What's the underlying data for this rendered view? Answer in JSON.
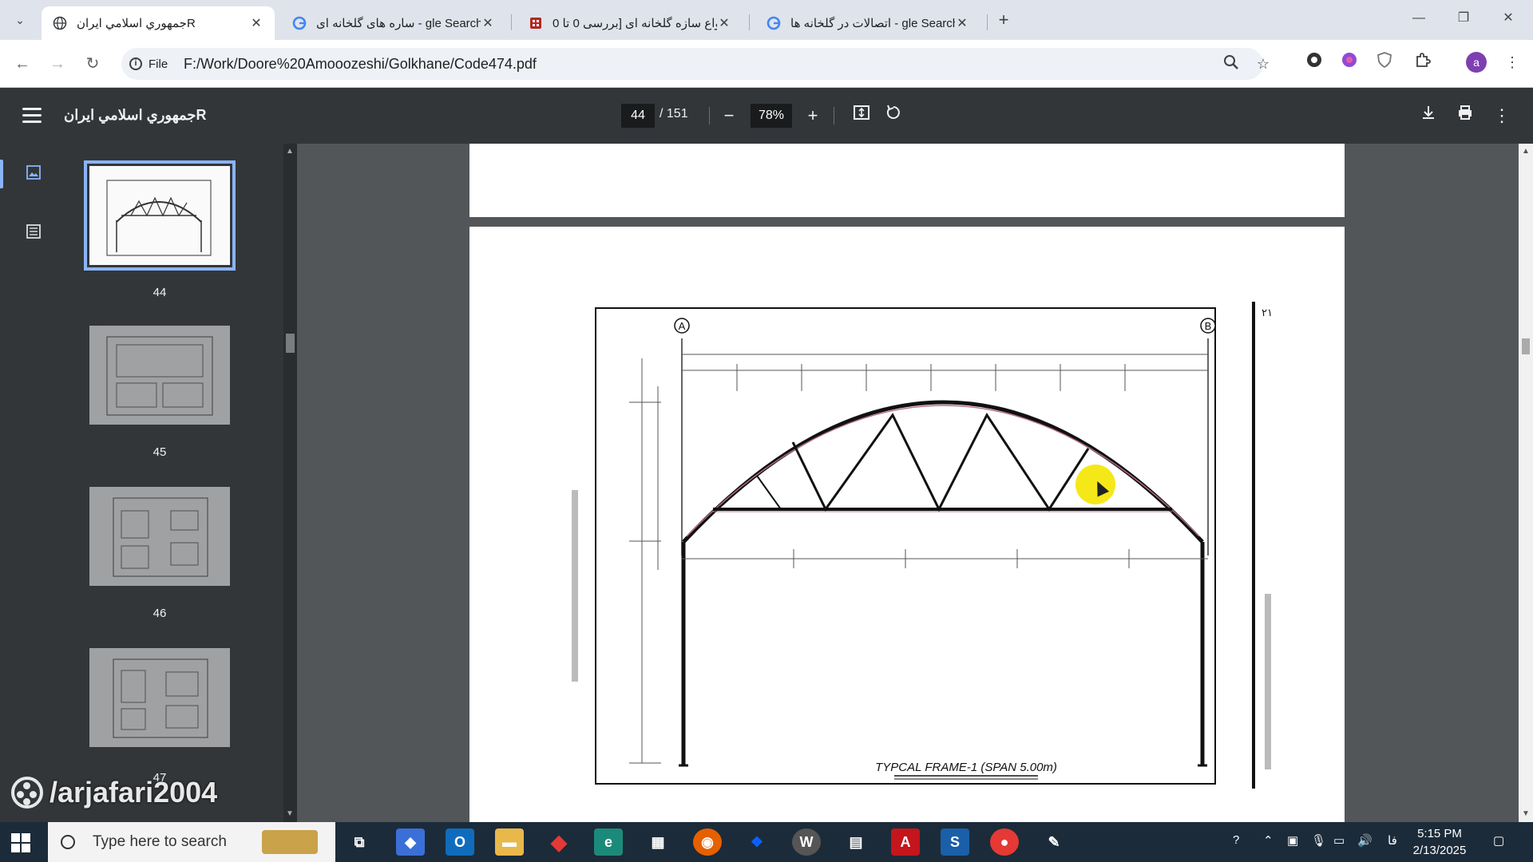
{
  "browser": {
    "tabs": [
      {
        "title": "جمهوري اسلامي ايرانR",
        "active": true,
        "favicon": "globe-icon"
      },
      {
        "title": "ساره های گلخانه ای - gle Search",
        "active": false,
        "favicon": "google-icon"
      },
      {
        "title": "انواع سازه گلخانه ای [بررسی 0 تا 0",
        "active": false,
        "favicon": "site-icon"
      },
      {
        "title": "اتصالات در گلخانه ها - gle Search",
        "active": false,
        "favicon": "google-icon"
      }
    ],
    "address": {
      "scheme_label": "File",
      "url": "F:/Work/Doore%20Amooozeshi/Golkhane/Code474.pdf"
    }
  },
  "pdf": {
    "title": "جمهوري اسلامي ايرانR",
    "current_page": "44",
    "total_pages": "/ 151",
    "zoom": "78%"
  },
  "thumbnails": [
    {
      "page": "44",
      "active": true
    },
    {
      "page": "45",
      "active": false
    },
    {
      "page": "46",
      "active": false
    },
    {
      "page": "47",
      "active": false
    }
  ],
  "drawing": {
    "caption": "TYPCAL FRAME-1 (SPAN 5.00m)",
    "axis_a": "A",
    "axis_b": "B",
    "page_mark": "٢١"
  },
  "watermark": "/arjafari2004",
  "taskbar": {
    "search_placeholder": "Type here to search",
    "lang": "فا",
    "time": "5:15 PM",
    "date": "2/13/2025"
  }
}
